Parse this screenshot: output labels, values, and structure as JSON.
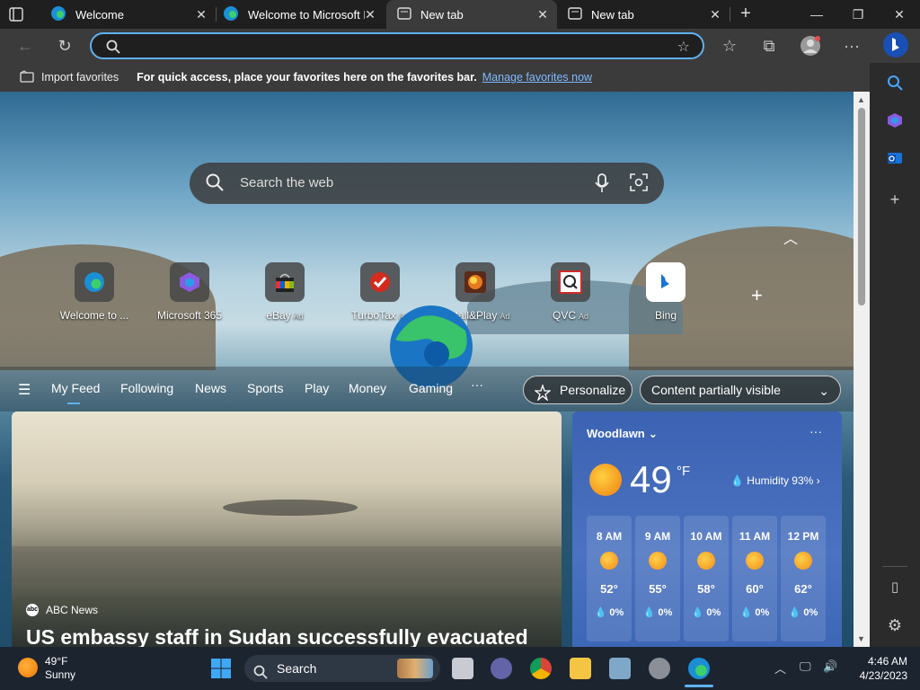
{
  "tabs": [
    {
      "title": "Welcome"
    },
    {
      "title": "Welcome to Microsoft E"
    },
    {
      "title": "New tab"
    },
    {
      "title": "New tab"
    }
  ],
  "favbar": {
    "import": "Import favorites",
    "hint": "For quick access, place your favorites here on the favorites bar.",
    "manage": "Manage favorites now"
  },
  "search": {
    "placeholder": "Search the web"
  },
  "quicklinks": [
    {
      "label": "Welcome to ...",
      "ad": ""
    },
    {
      "label": "Microsoft 365",
      "ad": ""
    },
    {
      "label": "eBay",
      "ad": "Ad"
    },
    {
      "label": "TurboTax",
      "ad": "Ad"
    },
    {
      "label": "Install&Play",
      "ad": "Ad"
    },
    {
      "label": "QVC",
      "ad": "Ad"
    },
    {
      "label": "Bing",
      "ad": ""
    }
  ],
  "feednav": {
    "items": [
      "My Feed",
      "Following",
      "News",
      "Sports",
      "Play",
      "Money",
      "Gaming"
    ],
    "more": "···",
    "personalize": "Personalize",
    "visibility": "Content partially visible"
  },
  "news": {
    "source": "ABC News",
    "headline": "US embassy staff in Sudan successfully evacuated"
  },
  "weather": {
    "location": "Woodlawn",
    "temp": "49",
    "unit": "°F",
    "humidity": "Humidity 93%",
    "hours": [
      {
        "time": "8 AM",
        "temp": "52°",
        "precip": "0%"
      },
      {
        "time": "9 AM",
        "temp": "55°",
        "precip": "0%"
      },
      {
        "time": "10 AM",
        "temp": "58°",
        "precip": "0%"
      },
      {
        "time": "11 AM",
        "temp": "60°",
        "precip": "0%"
      },
      {
        "time": "12 PM",
        "temp": "62°",
        "precip": "0%"
      }
    ]
  },
  "taskbar": {
    "weather_temp": "49°F",
    "weather_desc": "Sunny",
    "search": "Search",
    "time": "4:46 AM",
    "date": "4/23/2023"
  },
  "colors": {
    "accent": "#5fb2f2",
    "link": "#7fb8ff"
  }
}
